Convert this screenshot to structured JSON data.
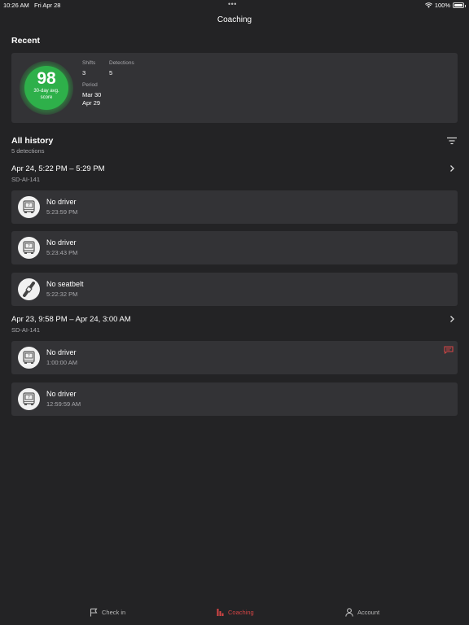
{
  "status_bar": {
    "time": "10:26 AM",
    "date": "Fri Apr 28",
    "battery": "100%",
    "dots": "•••"
  },
  "nav": {
    "title": "Coaching"
  },
  "recent": {
    "title": "Recent",
    "score": "98",
    "score_label": "30-day avg. score",
    "score_color": "#2eb04a",
    "shifts_label": "Shifts",
    "shifts_value": "3",
    "detections_label": "Detections",
    "detections_value": "5",
    "period_label": "Period",
    "period_start": "Mar 30",
    "period_end": "Apr 29"
  },
  "history": {
    "title": "All history",
    "count": "5 detections",
    "groups": [
      {
        "range": "Apr 24, 5:22 PM – 5:29 PM",
        "vehicle": "SD-AI-141",
        "events": [
          {
            "name": "No driver",
            "time": "5:23:59 PM",
            "icon": "bus-icon"
          },
          {
            "name": "No driver",
            "time": "5:23:43 PM",
            "icon": "bus-icon"
          },
          {
            "name": "No seatbelt",
            "time": "5:22:32 PM",
            "icon": "seatbelt-icon"
          }
        ]
      },
      {
        "range": "Apr 23, 9:58 PM – Apr 24, 3:00 AM",
        "vehicle": "SD-AI-141",
        "events": [
          {
            "name": "No driver",
            "time": "1:00:00 AM",
            "icon": "bus-icon",
            "has_comment": true
          },
          {
            "name": "No driver",
            "time": "12:59:59 AM",
            "icon": "bus-icon"
          }
        ]
      }
    ]
  },
  "tabs": [
    {
      "label": "Check in",
      "icon": "flag-icon",
      "active": false
    },
    {
      "label": "Coaching",
      "icon": "bar-chart-icon",
      "active": true
    },
    {
      "label": "Account",
      "icon": "person-icon",
      "active": false
    }
  ],
  "colors": {
    "accent": "#d64545",
    "background": "#232325",
    "card": "#333336",
    "score": "#2eb04a"
  }
}
